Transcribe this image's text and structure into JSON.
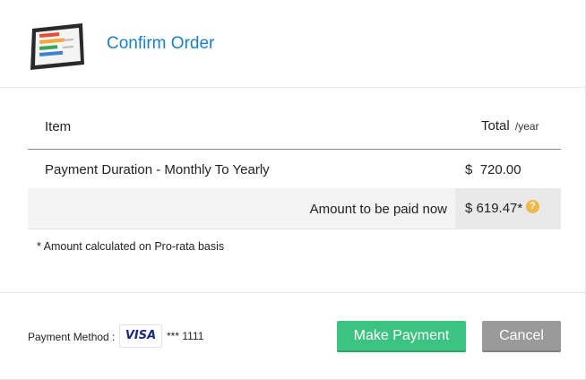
{
  "header": {
    "title": "Confirm Order",
    "icon": "report-tablet-icon"
  },
  "table": {
    "col_item": "Item",
    "col_total": "Total",
    "col_total_unit": "/year",
    "rows": [
      {
        "description": "Payment Duration - Monthly To Yearly",
        "currency": "$",
        "amount": "720.00"
      }
    ],
    "due_now": {
      "label": "Amount to be paid now",
      "currency": "$",
      "amount": "619.47*",
      "info_icon": "?"
    }
  },
  "footnote": "* Amount calculated on Pro-rata basis",
  "payment": {
    "method_label": "Payment Method :",
    "card_brand": "VISA",
    "card_number": "*** 1111"
  },
  "buttons": {
    "pay_label": "Make Payment",
    "cancel_label": "Cancel"
  },
  "colors": {
    "title": "#1d7fc2",
    "pay_button": "#3cc381",
    "cancel_button": "#9a9a9a",
    "info_icon": "#f0b74a"
  }
}
